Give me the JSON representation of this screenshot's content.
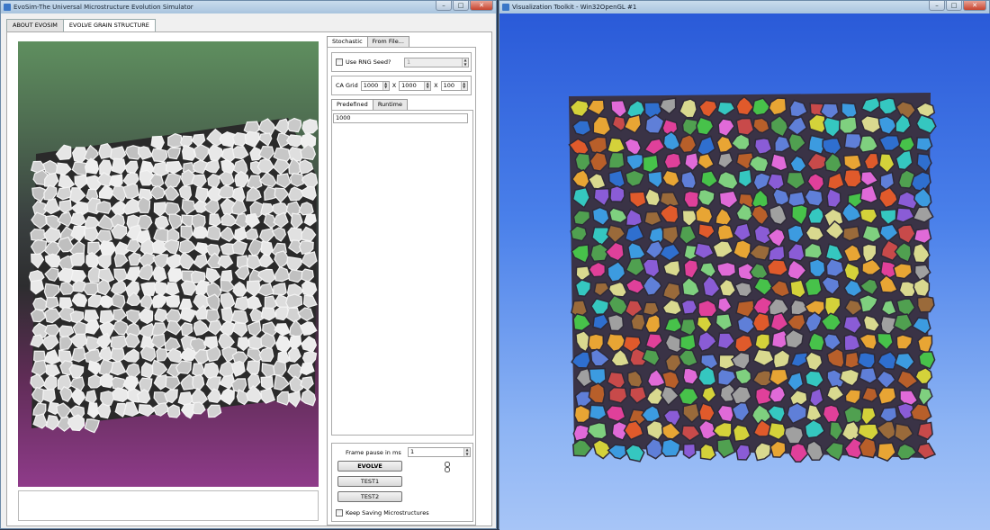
{
  "left_window": {
    "title": "EvoSim-The Universal Microstructure Evolution Simulator",
    "tabs": [
      {
        "label": "ABOUT EVOSIM",
        "active": false
      },
      {
        "label": "EVOLVE GRAIN STRUCTURE",
        "active": true
      }
    ],
    "source_tabs": [
      {
        "label": "Stochastic",
        "active": true
      },
      {
        "label": "From File...",
        "active": false
      }
    ],
    "rng": {
      "checkbox_label": "Use RNG Seed?",
      "checked": false,
      "seed_value": "1"
    },
    "ca_grid": {
      "label": "CA Grid",
      "x": "1000",
      "sep1": "X",
      "y": "1000",
      "sep2": "X",
      "z": "100"
    },
    "mode_tabs": [
      {
        "label": "Predefined",
        "active": true
      },
      {
        "label": "Runtime",
        "active": false
      }
    ],
    "predefined_value": "1000",
    "frame_pause": {
      "label": "Frame pause in ms",
      "value": "1"
    },
    "buttons": {
      "evolve": "EVOLVE",
      "test1": "TEST1",
      "test2": "TEST2"
    },
    "keep_saving": {
      "label": "Keep Saving  Microstructures",
      "checked": false
    },
    "viewport_colors": {
      "top": "#5f8f5f",
      "bottom": "#8f3b8a",
      "grain": "#d8d8d8"
    }
  },
  "right_window": {
    "title": "Visualization Toolkit - Win32OpenGL #1",
    "background_top": "#2a5ad8",
    "background_bottom": "#a7c5f7"
  },
  "window_buttons": {
    "minimize": "–",
    "maximize": "□",
    "close": "✕"
  }
}
